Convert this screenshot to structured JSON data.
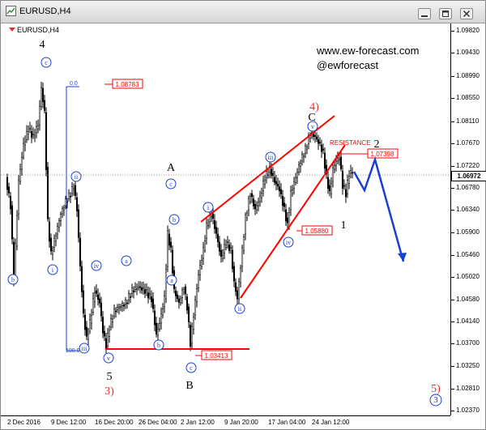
{
  "window": {
    "title": "EURUSD,H4"
  },
  "chart": {
    "symbol_label": "EURUSD,H4",
    "current_price": "1.06972",
    "watermark": {
      "site": "www.ew-forecast.com",
      "handle": "@ewforecast"
    },
    "price_ticks": [
      "1.09820",
      "1.09430",
      "1.08990",
      "1.08550",
      "1.08110",
      "1.07670",
      "1.07220",
      "1.06780",
      "1.06340",
      "1.05900",
      "1.05460",
      "1.05020",
      "1.04580",
      "1.04140",
      "1.03700",
      "1.03250",
      "1.02810",
      "1.02370"
    ],
    "time_ticks": [
      "2 Dec 2016",
      "9 Dec 12:00",
      "16 Dec 20:00",
      "26 Dec 04:00",
      "2 Jan 12:00",
      "9 Jan 20:00",
      "17 Jan 04:00",
      "24 Jan 12:00"
    ],
    "boxes": [
      "1.08783",
      "1.03413",
      "1.05880",
      "1.07398"
    ],
    "fib_levels": [
      "0.0",
      "100.0"
    ],
    "resistance_label": "RESISTANCE",
    "wave_labels": {
      "w4": "4",
      "w5": "5",
      "w3red": "3)",
      "wA": "A",
      "wB": "B",
      "wC": "C",
      "w4red": "4)",
      "w1": "1",
      "w2": "2",
      "w5red": "5)"
    },
    "circle_labels": {
      "c_top": "c",
      "ii_left": "ii",
      "i_left": "i",
      "b_left": "b",
      "iii_low": "iii",
      "iv_mid": "iv",
      "a_mid": "a",
      "v_low": "v",
      "c_A": "c",
      "b_A": "b",
      "a_A": "a",
      "b_low": "b",
      "c_B": "c",
      "i_right": "i",
      "ii_right": "ii",
      "iii_right": "iii",
      "iv_right": "iv",
      "v_top": "v",
      "three_big": "3"
    },
    "colors": {
      "candles": "#000000",
      "trend": "#ff0000",
      "circle": "#1a3fd4",
      "projection": "#1a3fd4",
      "box_red": "#ff0000"
    }
  }
}
